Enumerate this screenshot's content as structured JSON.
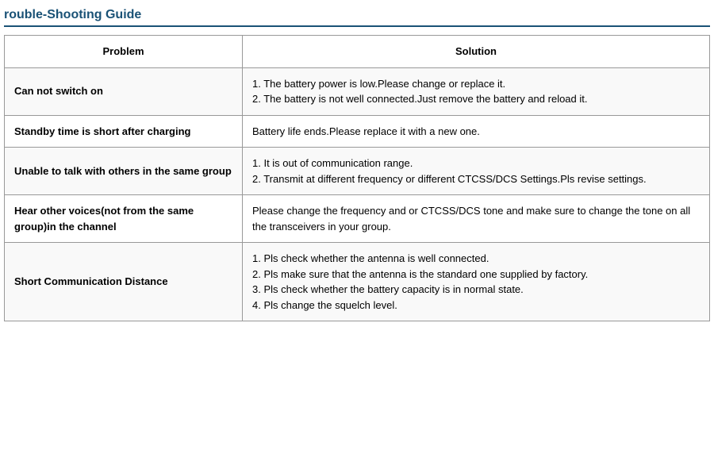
{
  "page": {
    "title": "rouble-Shooting Guide"
  },
  "table": {
    "header": {
      "problem": "Problem",
      "solution": "Solution"
    },
    "rows": [
      {
        "problem": "Can not switch on",
        "solution": "1. The battery power is low.Please change or replace it.\n2. The battery is not well connected.Just remove the battery and reload it."
      },
      {
        "problem": "Standby time is short after charging",
        "solution": "Battery life ends.Please replace it with a new one."
      },
      {
        "problem": "Unable to talk with others in the same group",
        "solution": "1. It is out of communication range.\n2. Transmit at different frequency or different CTCSS/DCS Settings.Pls revise settings."
      },
      {
        "problem": "Hear other voices(not from the same group)in the channel",
        "solution": "Please change the frequency and or CTCSS/DCS tone and make sure to change the tone on all the transceivers in your group."
      },
      {
        "problem": "Short Communication Distance",
        "solution": "1. Pls check whether the antenna is well connected.\n2. Pls make sure that the antenna is the standard one supplied by factory.\n3. Pls check whether the battery capacity is in normal state.\n4. Pls change the squelch level."
      }
    ]
  }
}
